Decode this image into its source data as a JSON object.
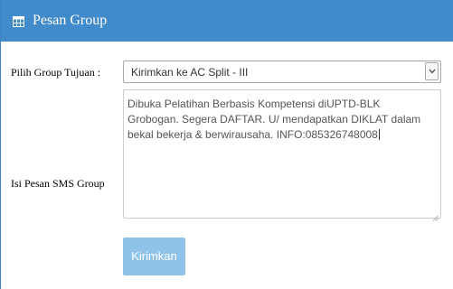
{
  "panel": {
    "title": "Pesan Group",
    "icon": "table-icon",
    "header_color": "#428bca"
  },
  "form": {
    "group_label": "Pilih Group Tujuan :",
    "group_selected": "Kirimkan ke AC Split - III",
    "message_label": "Isi Pesan SMS Group",
    "message_text": "Dibuka Pelatihan Berbasis Kompetensi diUPTD-BLK Grobogan. Segera DAFTAR. U/ mendapatkan DIKLAT dalam bekal bekerja & berwirausaha. INFO:085326748008",
    "submit_label": "Kirimkan",
    "submit_color": "#8fc3ea"
  }
}
